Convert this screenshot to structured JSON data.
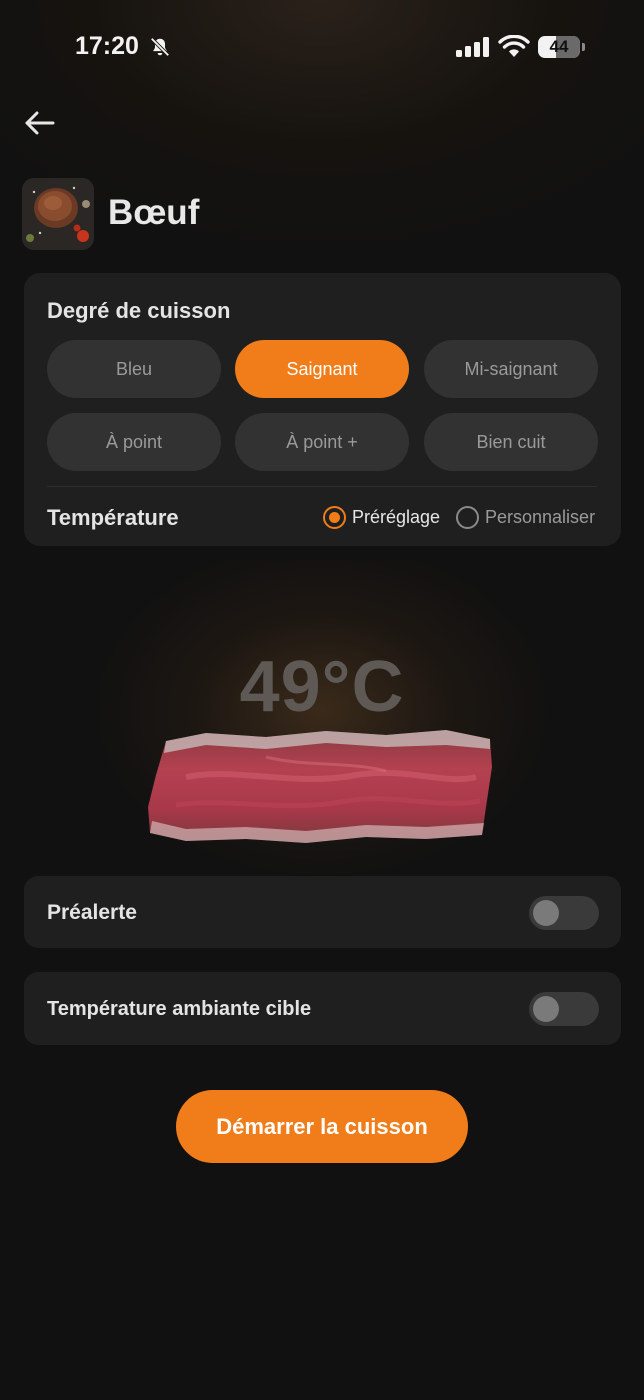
{
  "status_bar": {
    "time": "17:20",
    "battery": "44",
    "battery_level": 0.44,
    "icons": [
      "bell-off-icon",
      "signal-icon",
      "wifi-icon",
      "battery-icon"
    ]
  },
  "header": {
    "back_icon": "arrow-left-icon",
    "title": "Bœuf"
  },
  "doneness": {
    "title": "Degré de cuisson",
    "selected": "Saignant",
    "options": [
      {
        "label": "Bleu"
      },
      {
        "label": "Saignant"
      },
      {
        "label": "Mi-saignant"
      },
      {
        "label": "À point"
      },
      {
        "label": "À point +"
      },
      {
        "label": "Bien cuit"
      }
    ]
  },
  "temperature": {
    "label": "Température",
    "mode_selected": "Préréglage",
    "modes": [
      {
        "label": "Préréglage"
      },
      {
        "label": "Personnaliser"
      }
    ],
    "value": "49°C"
  },
  "toggles": [
    {
      "label": "Préalerte",
      "on": false
    },
    {
      "label": "Température ambiante cible",
      "on": false
    }
  ],
  "actions": {
    "start_label": "Démarrer la cuisson"
  },
  "colors": {
    "accent": "#f07d1a",
    "background": "#111111",
    "card": "#1f1f1f",
    "pill": "#323232"
  }
}
